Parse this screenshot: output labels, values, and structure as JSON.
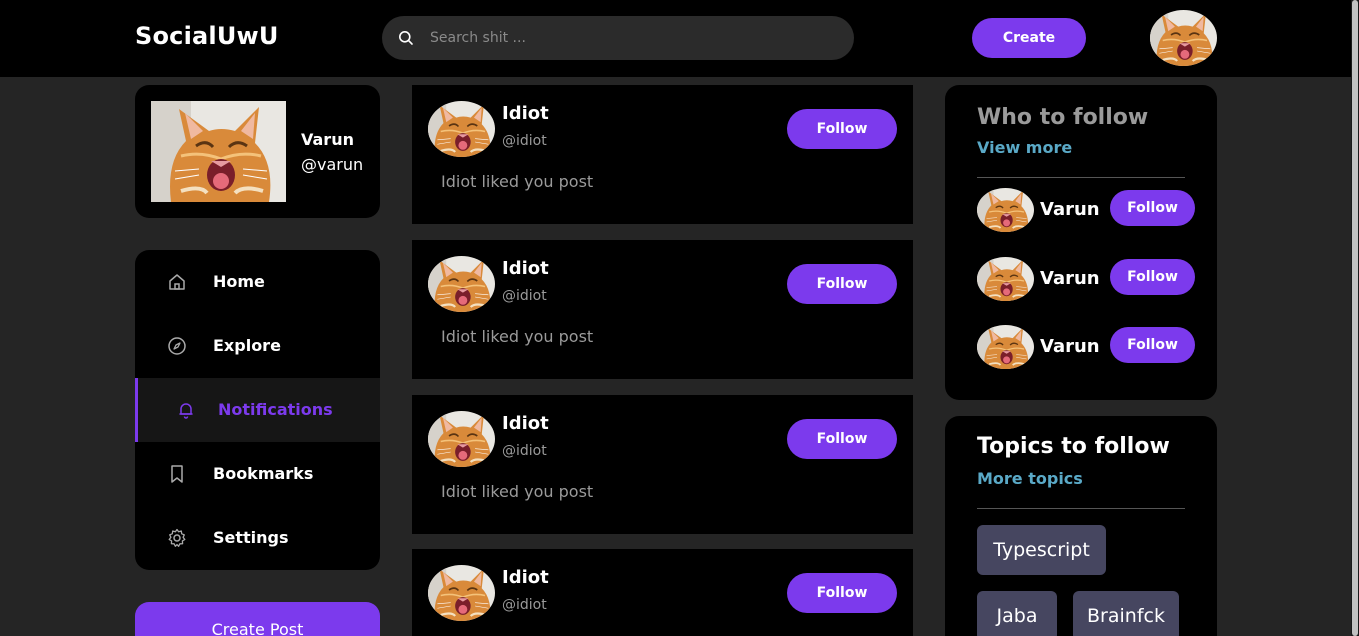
{
  "header": {
    "logo": "SocialUwU",
    "search_placeholder": "Search shit ...",
    "create_label": "Create"
  },
  "profile": {
    "name": "Varun",
    "handle": "@varun"
  },
  "nav": {
    "items": [
      {
        "label": "Home",
        "icon": "home-icon"
      },
      {
        "label": "Explore",
        "icon": "compass-icon"
      },
      {
        "label": "Notifications",
        "icon": "bell-icon",
        "active": true
      },
      {
        "label": "Bookmarks",
        "icon": "bookmark-icon"
      },
      {
        "label": "Settings",
        "icon": "gear-icon"
      }
    ],
    "create_post_label": "Create Post"
  },
  "notifications": [
    {
      "name": "Idiot",
      "handle": "@idiot",
      "text": "Idiot liked you post",
      "follow_label": "Follow"
    },
    {
      "name": "Idiot",
      "handle": "@idiot",
      "text": "Idiot liked you post",
      "follow_label": "Follow"
    },
    {
      "name": "Idiot",
      "handle": "@idiot",
      "text": "Idiot liked you post",
      "follow_label": "Follow"
    },
    {
      "name": "Idiot",
      "handle": "@idiot",
      "text": "",
      "follow_label": "Follow"
    }
  ],
  "who_to_follow": {
    "title": "Who to follow",
    "view_more": "View more",
    "users": [
      {
        "name": "Varun",
        "follow_label": "Follow"
      },
      {
        "name": "Varun",
        "follow_label": "Follow"
      },
      {
        "name": "Varun",
        "follow_label": "Follow"
      }
    ]
  },
  "topics": {
    "title": "Topics to follow",
    "more": "More topics",
    "items": [
      "Typescript",
      "Jaba",
      "Brainfck"
    ]
  },
  "colors": {
    "accent": "#7c3aed",
    "link": "#5aa9c7",
    "chip": "#464660",
    "background": "#252525",
    "panel": "#000000"
  }
}
